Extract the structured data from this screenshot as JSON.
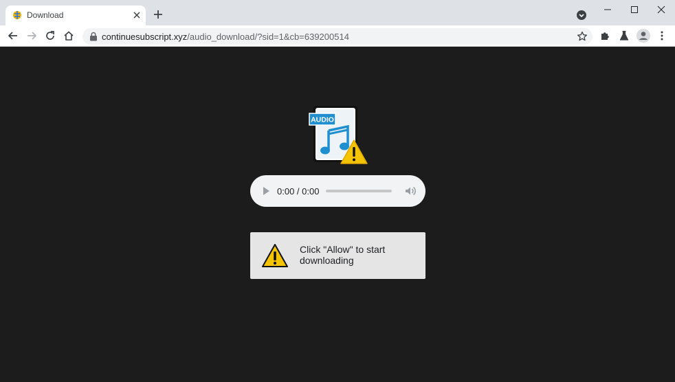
{
  "browser": {
    "tab_title": "Download",
    "url_domain": "continuesubscript.xyz",
    "url_path": "/audio_download/?sid=1&cb=639200514"
  },
  "icons": {
    "tab_favicon": "globe-favicon-icon",
    "tab_close": "close-icon",
    "new_tab": "plus-icon",
    "tab_search": "tab-search-icon",
    "back": "back-arrow-icon",
    "forward": "forward-arrow-icon",
    "reload": "reload-icon",
    "home": "home-icon",
    "lock": "lock-icon",
    "bookmark": "star-icon",
    "extensions": "puzzle-icon",
    "labs": "flask-icon",
    "profile": "avatar-icon",
    "menu": "kebab-menu-icon"
  },
  "content": {
    "file_icon_badge": "AUDIO",
    "player_time": "0:00 / 0:00",
    "notice_text": "Click \"Allow\" to start downloading"
  },
  "colors": {
    "page_background": "#1c1c1c",
    "notice_background": "#e5e5e5",
    "warning_yellow": "#f5c400",
    "audio_badge_blue": "#1f8fd0"
  }
}
